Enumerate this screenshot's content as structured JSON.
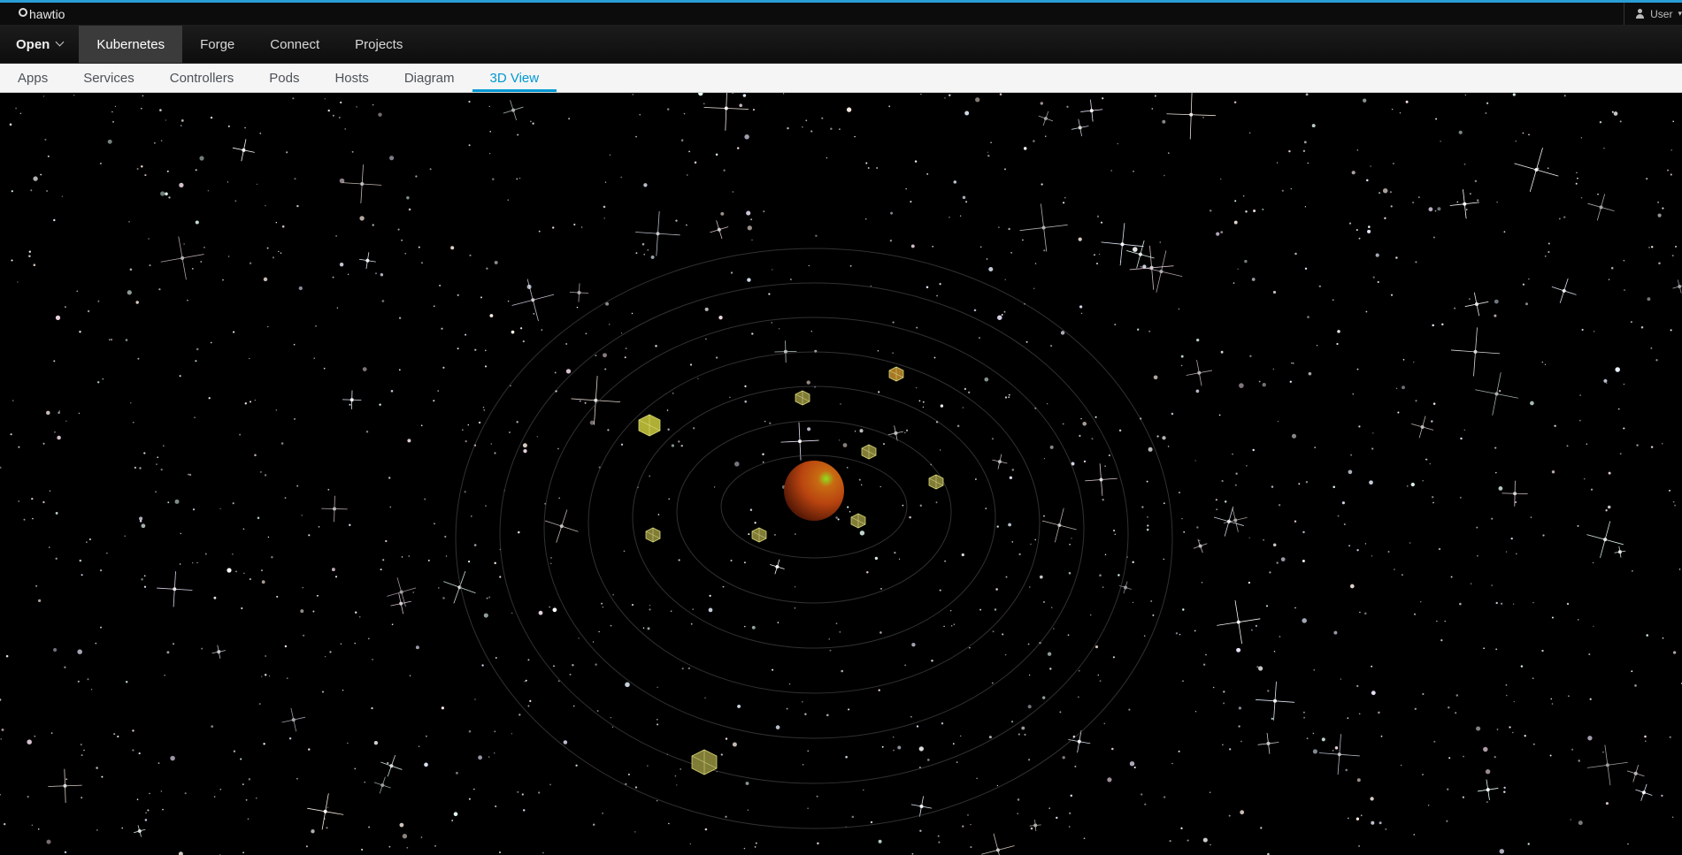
{
  "app": {
    "brand": "hawtio",
    "user_label": "User"
  },
  "primary_nav": {
    "open_label": "Open",
    "items": [
      {
        "label": "Kubernetes",
        "active": true
      },
      {
        "label": "Forge",
        "active": false
      },
      {
        "label": "Connect",
        "active": false
      },
      {
        "label": "Projects",
        "active": false
      }
    ]
  },
  "secondary_nav": {
    "items": [
      {
        "label": "Apps",
        "active": false
      },
      {
        "label": "Services",
        "active": false
      },
      {
        "label": "Controllers",
        "active": false
      },
      {
        "label": "Pods",
        "active": false
      },
      {
        "label": "Hosts",
        "active": false
      },
      {
        "label": "Diagram",
        "active": false
      },
      {
        "label": "3D View",
        "active": true
      }
    ]
  },
  "scene": {
    "orbit_count": 7,
    "pod_count": 9
  },
  "colors": {
    "accent": "#2a9fd6",
    "active_tab": "#0099d3",
    "planet": "#c44d12",
    "planet_highlight": "#7acc1a",
    "pod": "#d8d34a"
  },
  "icons": {
    "brand": "hawtio-logo-icon",
    "user": "user-icon",
    "dropdown": "chevron-down-icon"
  }
}
